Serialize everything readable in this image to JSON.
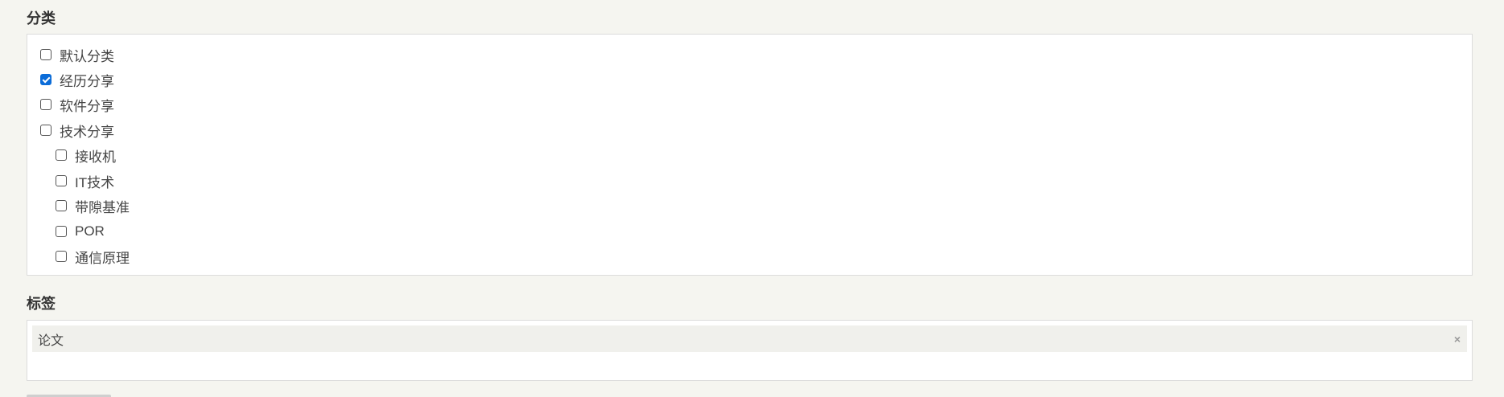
{
  "categories_section": {
    "title": "分类",
    "items": [
      {
        "label": "默认分类",
        "checked": false,
        "level": 0
      },
      {
        "label": "经历分享",
        "checked": true,
        "level": 0
      },
      {
        "label": "软件分享",
        "checked": false,
        "level": 0
      },
      {
        "label": "技术分享",
        "checked": false,
        "level": 0
      },
      {
        "label": "接收机",
        "checked": false,
        "level": 1
      },
      {
        "label": "IT技术",
        "checked": false,
        "level": 1
      },
      {
        "label": "带隙基准",
        "checked": false,
        "level": 1
      },
      {
        "label": "POR",
        "checked": false,
        "level": 1
      },
      {
        "label": "通信原理",
        "checked": false,
        "level": 1
      }
    ]
  },
  "tags_section": {
    "title": "标签",
    "tags": [
      {
        "label": "论文",
        "remove_symbol": "×"
      }
    ]
  },
  "colors": {
    "checkbox_checked": "#0b6cd8",
    "background": "#f5f5f0"
  }
}
